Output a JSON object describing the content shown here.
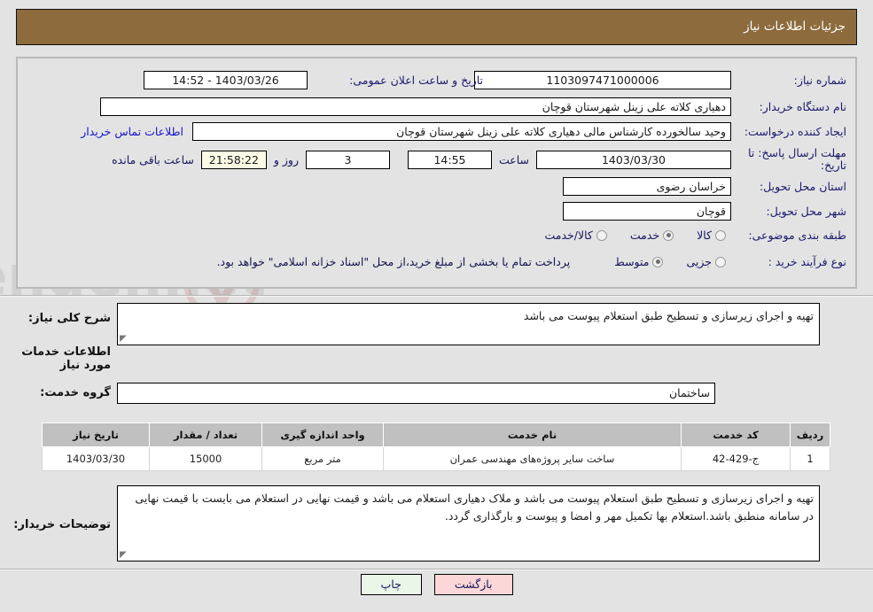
{
  "header": {
    "title": "جزئیات اطلاعات نیاز",
    "bar_color": "#8d6b3d"
  },
  "fields": {
    "need_number_label": "شماره نیاز:",
    "need_number_value": "1103097471000006",
    "announce_datetime_label": "تاریخ و ساعت اعلان عمومی:",
    "announce_datetime_value": "1403/03/26 - 14:52",
    "buyer_org_label": "نام دستگاه خریدار:",
    "buyer_org_value": "دهیاری کلاته علی زینل  شهرستان قوچان",
    "requester_label": "ایجاد کننده درخواست:",
    "requester_value": "وحید سالخورده کارشناس مالی دهیاری کلاته علی زینل  شهرستان قوچان",
    "buyer_contact_link": "اطلاعات تماس خریدار",
    "deadline_label": "مهلت ارسال پاسخ: تا تاریخ:",
    "deadline_date": "1403/03/30",
    "deadline_hour_label": "ساعت",
    "deadline_hour_value": "14:55",
    "remaining_days_value": "3",
    "remaining_days_label": "روز و",
    "remaining_time_value": "21:58:22",
    "remaining_time_label": "ساعت باقی مانده",
    "province_label": "استان محل تحویل:",
    "province_value": "خراسان رضوی",
    "city_label": "شهر محل تحویل:",
    "city_value": "قوچان",
    "category_label": "طبقه بندی موضوعی:",
    "process_label": "نوع فرآیند خرید :",
    "payment_note": "پرداخت تمام یا بخشی از مبلغ خرید،از محل \"اسناد خزانه اسلامی\" خواهد بود."
  },
  "category_options": [
    {
      "label": "کالا",
      "checked": false
    },
    {
      "label": "خدمت",
      "checked": true
    },
    {
      "label": "کالا/خدمت",
      "checked": false
    }
  ],
  "process_options": [
    {
      "label": "جزیی",
      "checked": false
    },
    {
      "label": "متوسط",
      "checked": true
    }
  ],
  "summary": {
    "label": "شرح کلی نیاز:",
    "value": "تهیه و اجرای زیرسازی  و تسطیح طبق استعلام پیوست می باشد"
  },
  "services_section": {
    "title": "اطلاعات خدمات مورد نیاز",
    "group_label": "گروه خدمت:",
    "group_value": "ساختمان"
  },
  "table": {
    "columns": [
      "ردیف",
      "کد خدمت",
      "نام خدمت",
      "واحد اندازه گیری",
      "تعداد / مقدار",
      "تاریخ نیاز"
    ],
    "rows": [
      [
        "1",
        "ج-429-42",
        "ساخت سایر پروژه‌های مهندسی عمران",
        "متر مربع",
        "15000",
        "1403/03/30"
      ]
    ]
  },
  "buyer_notes": {
    "label": "توضیحات خریدار:",
    "value": "تهیه و اجرای زیرسازی  و تسطیح طبق استعلام پیوست می باشد و ملاک دهیاری استعلام می باشد و قیمت نهایی در استعلام می بایست با قیمت نهایی در سامانه منطبق باشد.استعلام بها تکمیل مهر و امضا و پیوست و بارگذاری گردد."
  },
  "buttons": {
    "print": "چاپ",
    "return": "بازگشت"
  },
  "watermark": {
    "text": "AriaTender.net"
  }
}
